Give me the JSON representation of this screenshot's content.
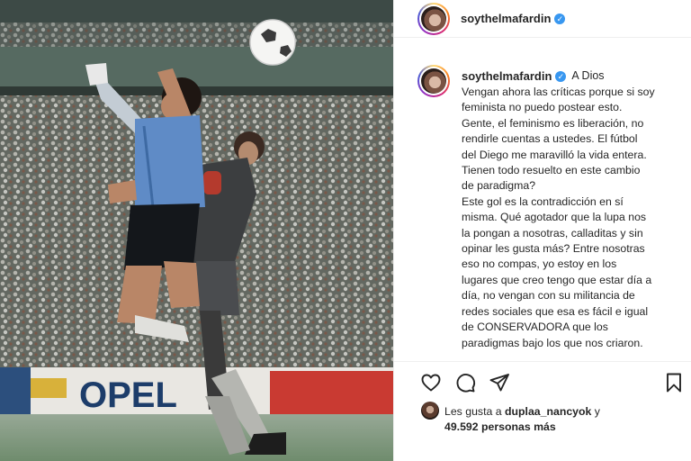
{
  "post": {
    "username": "soythelmafardin",
    "verified_mark": "✓",
    "location": "A Dios",
    "caption": "Vengan ahora las críticas porque si soy\nfeminista no puedo postear esto.\nGente, el feminismo es liberación, no\nrendirle cuentas a ustedes. El fútbol\ndel Diego me maravilló la vida entera.\nTienen todo resuelto en este cambio\nde paradigma?\nEste gol es la contradicción en sí\nmisma. Qué agotador que la lupa nos\nla pongan a nosotras, calladitas y sin\nopinar les gusta más? Entre nosotras\neso no compas, yo estoy en los\nlugares que creo tengo que estar día a\ndía, no vengan con su militancia de\nredes sociales que esa es fácil e igual\nde CONSERVADORA que los\nparadigmas bajo los que nos criaron.",
    "likes": {
      "prefix": "Les gusta a",
      "user": "duplaa_nancyok",
      "joiner": "y",
      "count": "49.592 personas más"
    }
  },
  "photo": {
    "board_text": "OPEL"
  },
  "icons": {
    "like": "heart-icon",
    "comment": "comment-icon",
    "share": "share-icon",
    "save": "bookmark-icon"
  }
}
